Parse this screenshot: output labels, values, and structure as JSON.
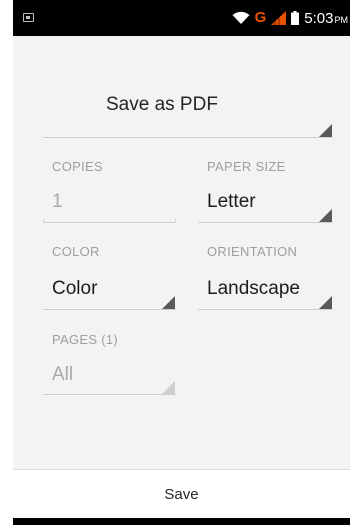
{
  "status_bar": {
    "icons": [
      "screenshot-notification-icon",
      "wifi-icon",
      "network-g-icon",
      "signal-icon",
      "battery-icon"
    ],
    "network_label": "G",
    "time": "5:03",
    "ampm": "PM",
    "accent_color": "#e65100"
  },
  "destination": {
    "value": "Save as PDF"
  },
  "copies": {
    "label": "COPIES",
    "value": "1"
  },
  "paper_size": {
    "label": "PAPER SIZE",
    "value": "Letter"
  },
  "color": {
    "label": "COLOR",
    "value": "Color"
  },
  "orientation": {
    "label": "ORIENTATION",
    "value": "Landscape"
  },
  "pages": {
    "label": "PAGES (1)",
    "value": "All"
  },
  "actions": {
    "save_label": "Save"
  }
}
